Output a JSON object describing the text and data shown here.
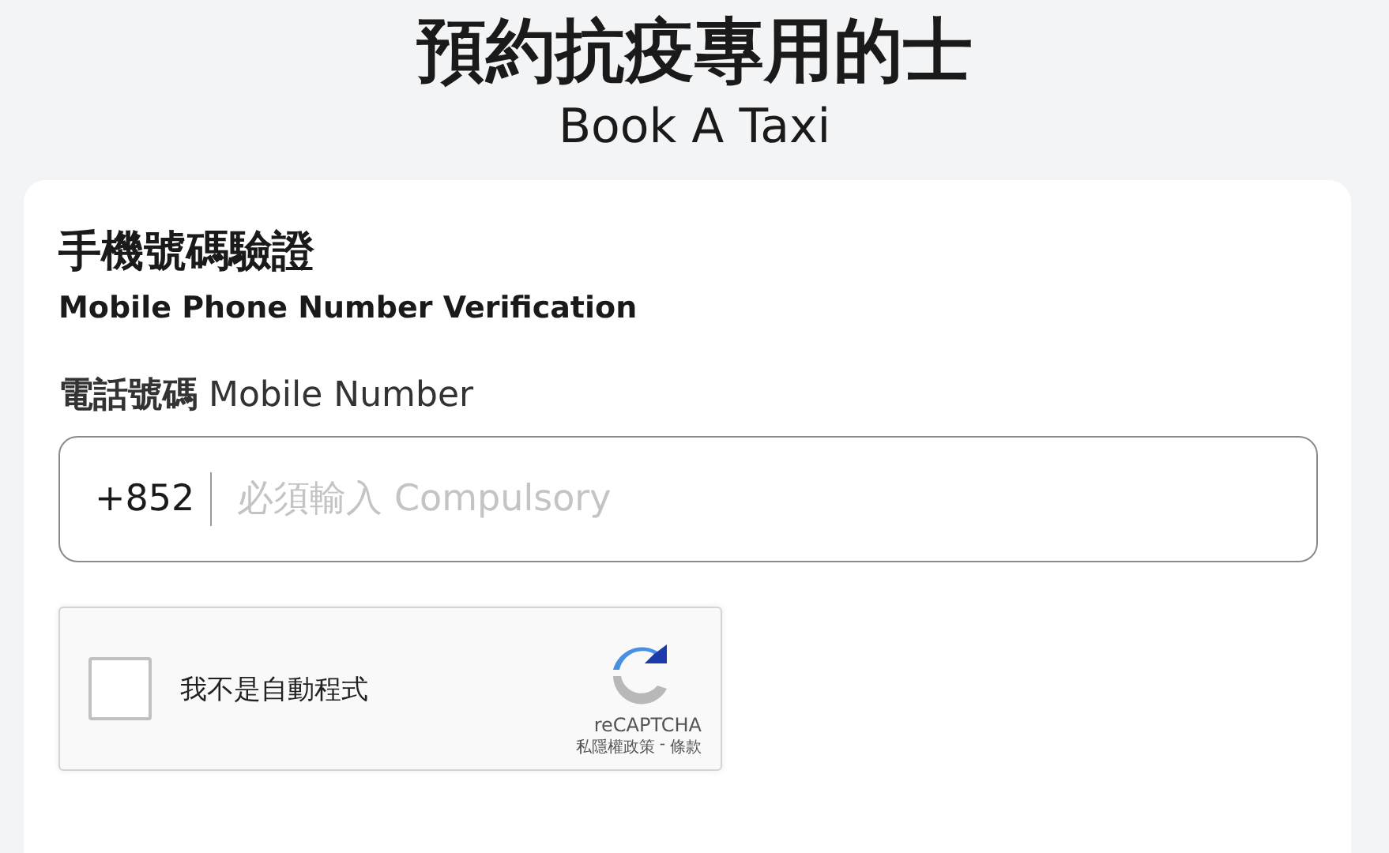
{
  "header": {
    "title": "預約抗疫專用的士",
    "subtitle": "Book A Taxi"
  },
  "card": {
    "heading": "手機號碼驗證",
    "subheading": "Mobile Phone Number Verification",
    "phone_field": {
      "label": "**電話號碼** Mobile Number",
      "prefix": "+852",
      "placeholder": "必須輸入 Compulsory"
    },
    "captcha": {
      "checked": false,
      "label": "我不是自動程式",
      "brand": "reCAPTCHA",
      "privacy_link": "私隱權政策",
      "separator": "-",
      "terms_link": "條款"
    }
  }
}
